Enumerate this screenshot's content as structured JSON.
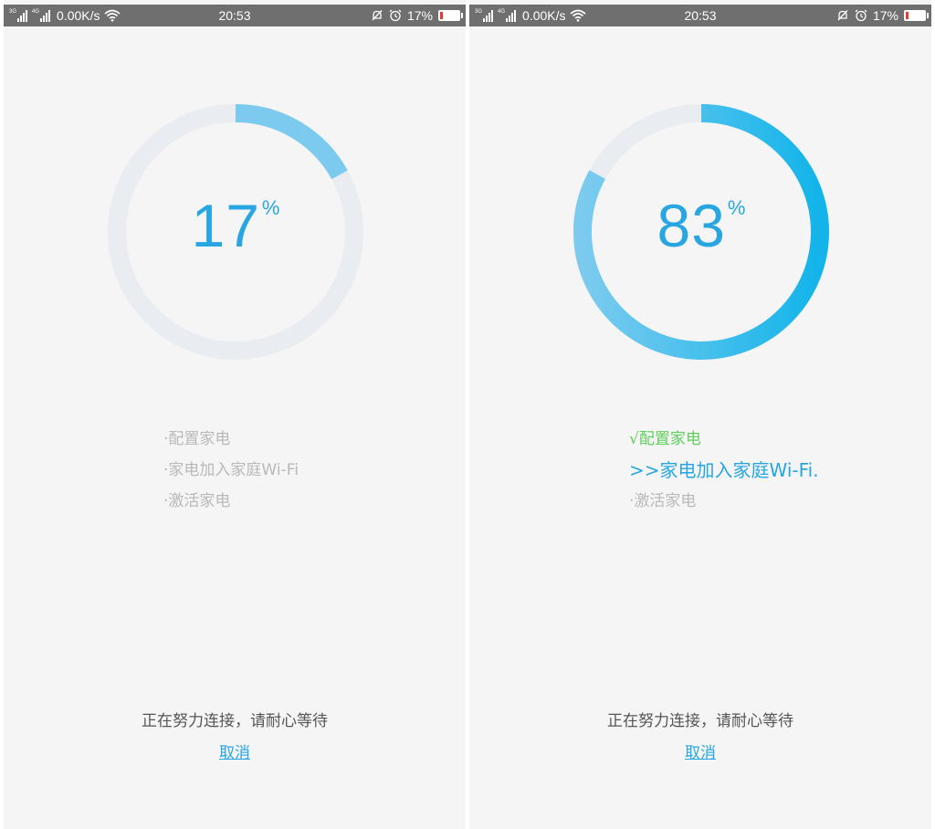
{
  "colors": {
    "accent": "#27a6e2",
    "track": "#e9ecf0",
    "done": "#5fcf5a",
    "pending": "#b9b9b9",
    "statusbar": "#6f6f6f",
    "battery_low": "#e53935"
  },
  "screens": [
    {
      "statusbar": {
        "net_speed": "0.00K/s",
        "time": "20:53",
        "battery": "17%"
      },
      "progress": {
        "value": 17,
        "display": "17",
        "unit": "%",
        "gradient": false
      },
      "steps": [
        {
          "label": "·配置家电",
          "state": "pending"
        },
        {
          "label": "·家电加入家庭Wi-Fi",
          "state": "pending"
        },
        {
          "label": "·激活家电",
          "state": "pending"
        }
      ],
      "wait_text": "正在努力连接，请耐心等待",
      "cancel_label": "取消"
    },
    {
      "statusbar": {
        "net_speed": "0.00K/s",
        "time": "20:53",
        "battery": "17%"
      },
      "progress": {
        "value": 83,
        "display": "83",
        "unit": "%",
        "gradient": true
      },
      "steps": [
        {
          "label": "√配置家电",
          "state": "done"
        },
        {
          "label": ">>家电加入家庭Wi-Fi.",
          "state": "active"
        },
        {
          "label": "·激活家电",
          "state": "pending"
        }
      ],
      "wait_text": "正在努力连接，请耐心等待",
      "cancel_label": "取消"
    }
  ]
}
